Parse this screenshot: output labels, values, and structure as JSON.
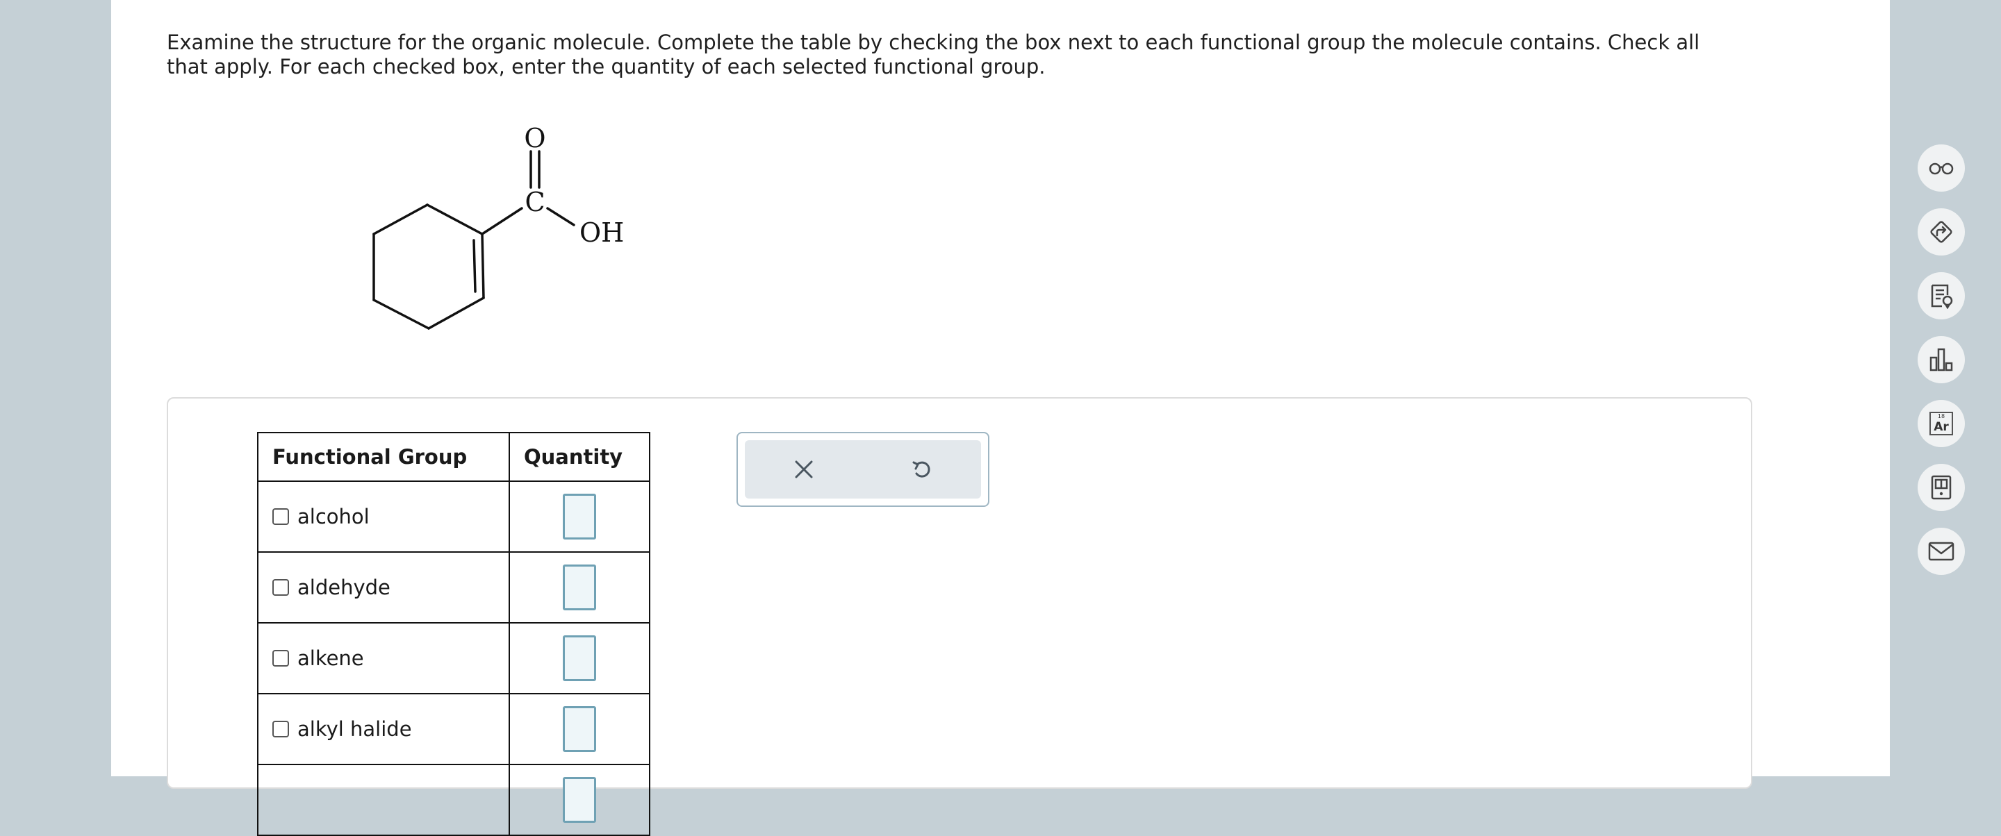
{
  "question": {
    "instructions": "Examine the structure for the organic molecule. Complete the table by checking the box next to each functional group the molecule contains. Check all that apply. For each checked box, enter the quantity of each selected functional group."
  },
  "molecule": {
    "atom_o": "O",
    "atom_c": "C",
    "atom_oh": "OH"
  },
  "table": {
    "header_group": "Functional Group",
    "header_quantity": "Quantity",
    "rows": [
      {
        "label": "alcohol",
        "checked": false,
        "quantity": ""
      },
      {
        "label": "aldehyde",
        "checked": false,
        "quantity": ""
      },
      {
        "label": "alkene",
        "checked": false,
        "quantity": ""
      },
      {
        "label": "alkyl halide",
        "checked": false,
        "quantity": ""
      }
    ]
  },
  "actions": {
    "clear_icon": "close-icon",
    "undo_icon": "undo-icon"
  },
  "side_tools": {
    "icons": [
      "glasses-icon",
      "share-icon",
      "notes-icon",
      "bar-chart-icon",
      "periodic-table-icon",
      "calculator-book-icon",
      "mail-icon"
    ],
    "periodic_number": "18",
    "periodic_symbol": "Ar"
  },
  "colors": {
    "input_border": "#6fa1b4",
    "input_fill": "#eef6f9",
    "backdrop": "#c5d0d6"
  }
}
